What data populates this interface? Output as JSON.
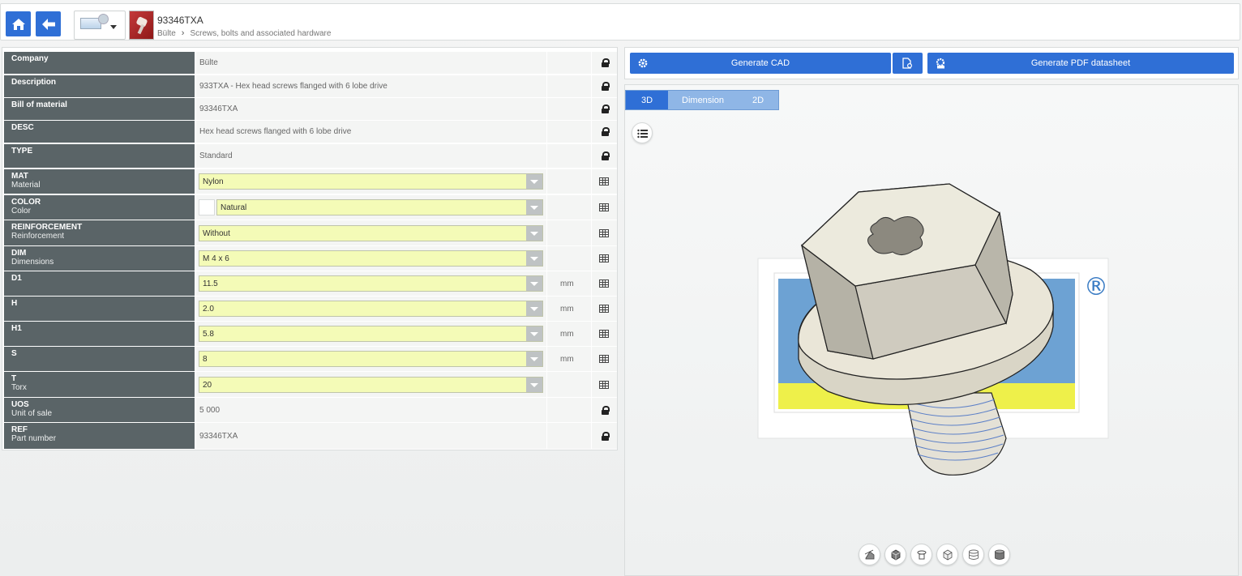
{
  "header": {
    "part_number": "93346TXA",
    "breadcrumb": [
      "Bülte",
      "Screws, bolts and associated hardware"
    ],
    "breadcrumb_separator": "›"
  },
  "attributes": [
    {
      "code": "Company",
      "label": "",
      "type": "static",
      "value": "Bülte",
      "unit": "",
      "icon": "lock-icon"
    },
    {
      "code": "Description",
      "label": "",
      "type": "static",
      "value": "933TXA - Hex head screws flanged with 6 lobe drive",
      "unit": "",
      "icon": "lock-icon"
    },
    {
      "code": "Bill of material",
      "label": "",
      "type": "static",
      "value": "93346TXA",
      "unit": "",
      "icon": "lock-icon"
    },
    {
      "code": "DESC",
      "label": "",
      "type": "static",
      "value": "Hex head screws flanged with 6 lobe drive",
      "unit": "",
      "icon": "lock-icon"
    },
    {
      "code": "TYPE",
      "label": "",
      "type": "static",
      "value": "Standard",
      "unit": "",
      "icon": "lock-icon"
    },
    {
      "code": "MAT",
      "label": "Material",
      "type": "select",
      "value": "Nylon",
      "unit": "",
      "icon": "table-icon"
    },
    {
      "code": "COLOR",
      "label": "Color",
      "type": "select-swatch",
      "value": "Natural",
      "unit": "",
      "icon": "table-icon"
    },
    {
      "code": "REINFORCEMENT",
      "label": "Reinforcement",
      "type": "select",
      "value": "Without",
      "unit": "",
      "icon": "table-icon"
    },
    {
      "code": "DIM",
      "label": "Dimensions",
      "type": "select",
      "value": "M 4 x 6",
      "unit": "",
      "icon": "table-icon"
    },
    {
      "code": "D1",
      "label": "",
      "type": "select",
      "value": "11.5",
      "unit": "mm",
      "icon": "table-icon"
    },
    {
      "code": "H",
      "label": "",
      "type": "select",
      "value": "2.0",
      "unit": "mm",
      "icon": "table-icon"
    },
    {
      "code": "H1",
      "label": "",
      "type": "select",
      "value": "5.8",
      "unit": "mm",
      "icon": "table-icon"
    },
    {
      "code": "S",
      "label": "",
      "type": "select",
      "value": "8",
      "unit": "mm",
      "icon": "table-icon"
    },
    {
      "code": "T",
      "label": "Torx",
      "type": "select",
      "value": "20",
      "unit": "",
      "icon": "table-icon"
    },
    {
      "code": "UOS",
      "label": "Unit of sale",
      "type": "static",
      "value": "5 000",
      "unit": "",
      "icon": "lock-icon"
    },
    {
      "code": "REF",
      "label": "Part number",
      "type": "static",
      "value": "93346TXA",
      "unit": "",
      "icon": "lock-icon"
    }
  ],
  "actions": {
    "generate_cad": "Generate CAD",
    "generate_pdf": "Generate PDF datasheet"
  },
  "viewer": {
    "tabs": [
      {
        "label": "3D",
        "active": true
      },
      {
        "label": "Dimension",
        "active": false
      },
      {
        "label": "2D",
        "active": false
      }
    ],
    "registered_mark": "®",
    "tools": [
      "view-perspective-icon",
      "shaded-cube-icon",
      "rotate-icon",
      "wireframe-cube-icon",
      "hidden-lines-icon",
      "solid-cylinder-icon"
    ]
  },
  "colors": {
    "primary": "#2f6fd6",
    "label_bg": "#5a6467",
    "select_bg": "#f4fbb7",
    "tab_inactive": "#8fb6e6"
  }
}
